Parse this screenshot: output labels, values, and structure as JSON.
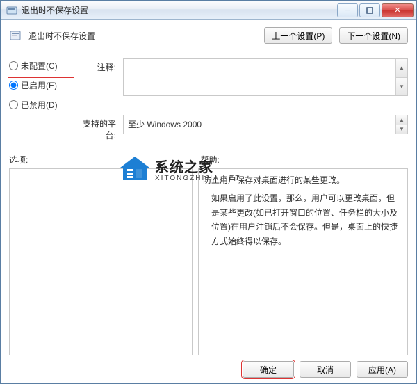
{
  "window": {
    "title": "退出时不保存设置"
  },
  "header": {
    "title": "退出时不保存设置",
    "prev": "上一个设置(P)",
    "next": "下一个设置(N)"
  },
  "radios": {
    "not_configured": "未配置(C)",
    "enabled": "已启用(E)",
    "disabled": "已禁用(D)",
    "selected": "enabled"
  },
  "labels": {
    "comment": "注释:",
    "platform": "支持的平台:",
    "options": "选项:",
    "help": "帮助:"
  },
  "platform_value": "至少 Windows 2000",
  "help_text": {
    "line1": "防止用户保存对桌面进行的某些更改。",
    "line2": "如果启用了此设置，那么，用户可以更改桌面，但是某些更改(如已打开窗口的位置、任务栏的大小及位置)在用户注销后不会保存。但是，桌面上的快捷方式始终得以保存。",
    "xit": "XITONGZHIJIA.NET"
  },
  "watermark": {
    "name": "系统之家"
  },
  "footer": {
    "ok": "确定",
    "cancel": "取消",
    "apply": "应用(A)"
  }
}
